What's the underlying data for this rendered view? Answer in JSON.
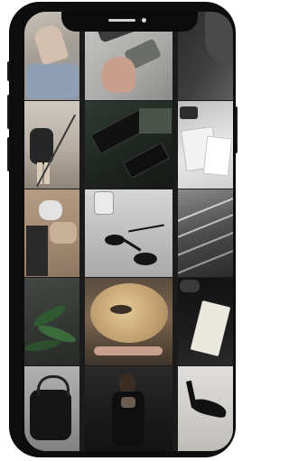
{
  "feed": {
    "tiles": [
      {
        "name": "woman-denim-shorts",
        "colors": [
          "#b8b3ac",
          "#8c8e93",
          "#d7cfc5"
        ]
      },
      {
        "name": "hand-holding-phone",
        "colors": [
          "#b8b8b6",
          "#9c9c9a",
          "#5b5b5b"
        ]
      },
      {
        "name": "dark-shoulder",
        "colors": [
          "#2a2a2a",
          "#3a3a3a",
          "#5c5c5c"
        ]
      },
      {
        "name": "woman-on-stairs",
        "colors": [
          "#bdb6ac",
          "#2b2b2b",
          "#8d857b"
        ]
      },
      {
        "name": "perfume-boxes",
        "colors": [
          "#26302a",
          "#1a1f1a",
          "#4a4f4a"
        ]
      },
      {
        "name": "shopping-bags",
        "colors": [
          "#e4e4e4",
          "#a9a9a9",
          "#2d2d2d"
        ]
      },
      {
        "name": "beige-knit-outfit",
        "colors": [
          "#a68f78",
          "#2a2a2a",
          "#c9b6a1"
        ]
      },
      {
        "name": "sunglasses-and-glass",
        "colors": [
          "#bfbfbf",
          "#1a1a1a",
          "#dedede"
        ]
      },
      {
        "name": "escalator",
        "colors": [
          "#5b5b5b",
          "#2a2a2a",
          "#b8b8b8"
        ]
      },
      {
        "name": "plant-leaves",
        "colors": [
          "#3b3d3b",
          "#2b4a2b",
          "#6b6e62"
        ]
      },
      {
        "name": "eye-through-wineglass",
        "colors": [
          "#caa978",
          "#8a6d4b",
          "#3d342a"
        ]
      },
      {
        "name": "book-reading",
        "colors": [
          "#161616",
          "#e9e6dc",
          "#4a4a4a"
        ]
      },
      {
        "name": "black-handbag",
        "colors": [
          "#9e9e9e",
          "#141414",
          "#6e6e6e"
        ]
      },
      {
        "name": "woman-in-dark-coat",
        "colors": [
          "#1c1c1c",
          "#3a2d22",
          "#6a6a6a"
        ]
      },
      {
        "name": "black-heels",
        "colors": [
          "#d4d2cd",
          "#161616",
          "#8a8a8a"
        ]
      }
    ]
  }
}
